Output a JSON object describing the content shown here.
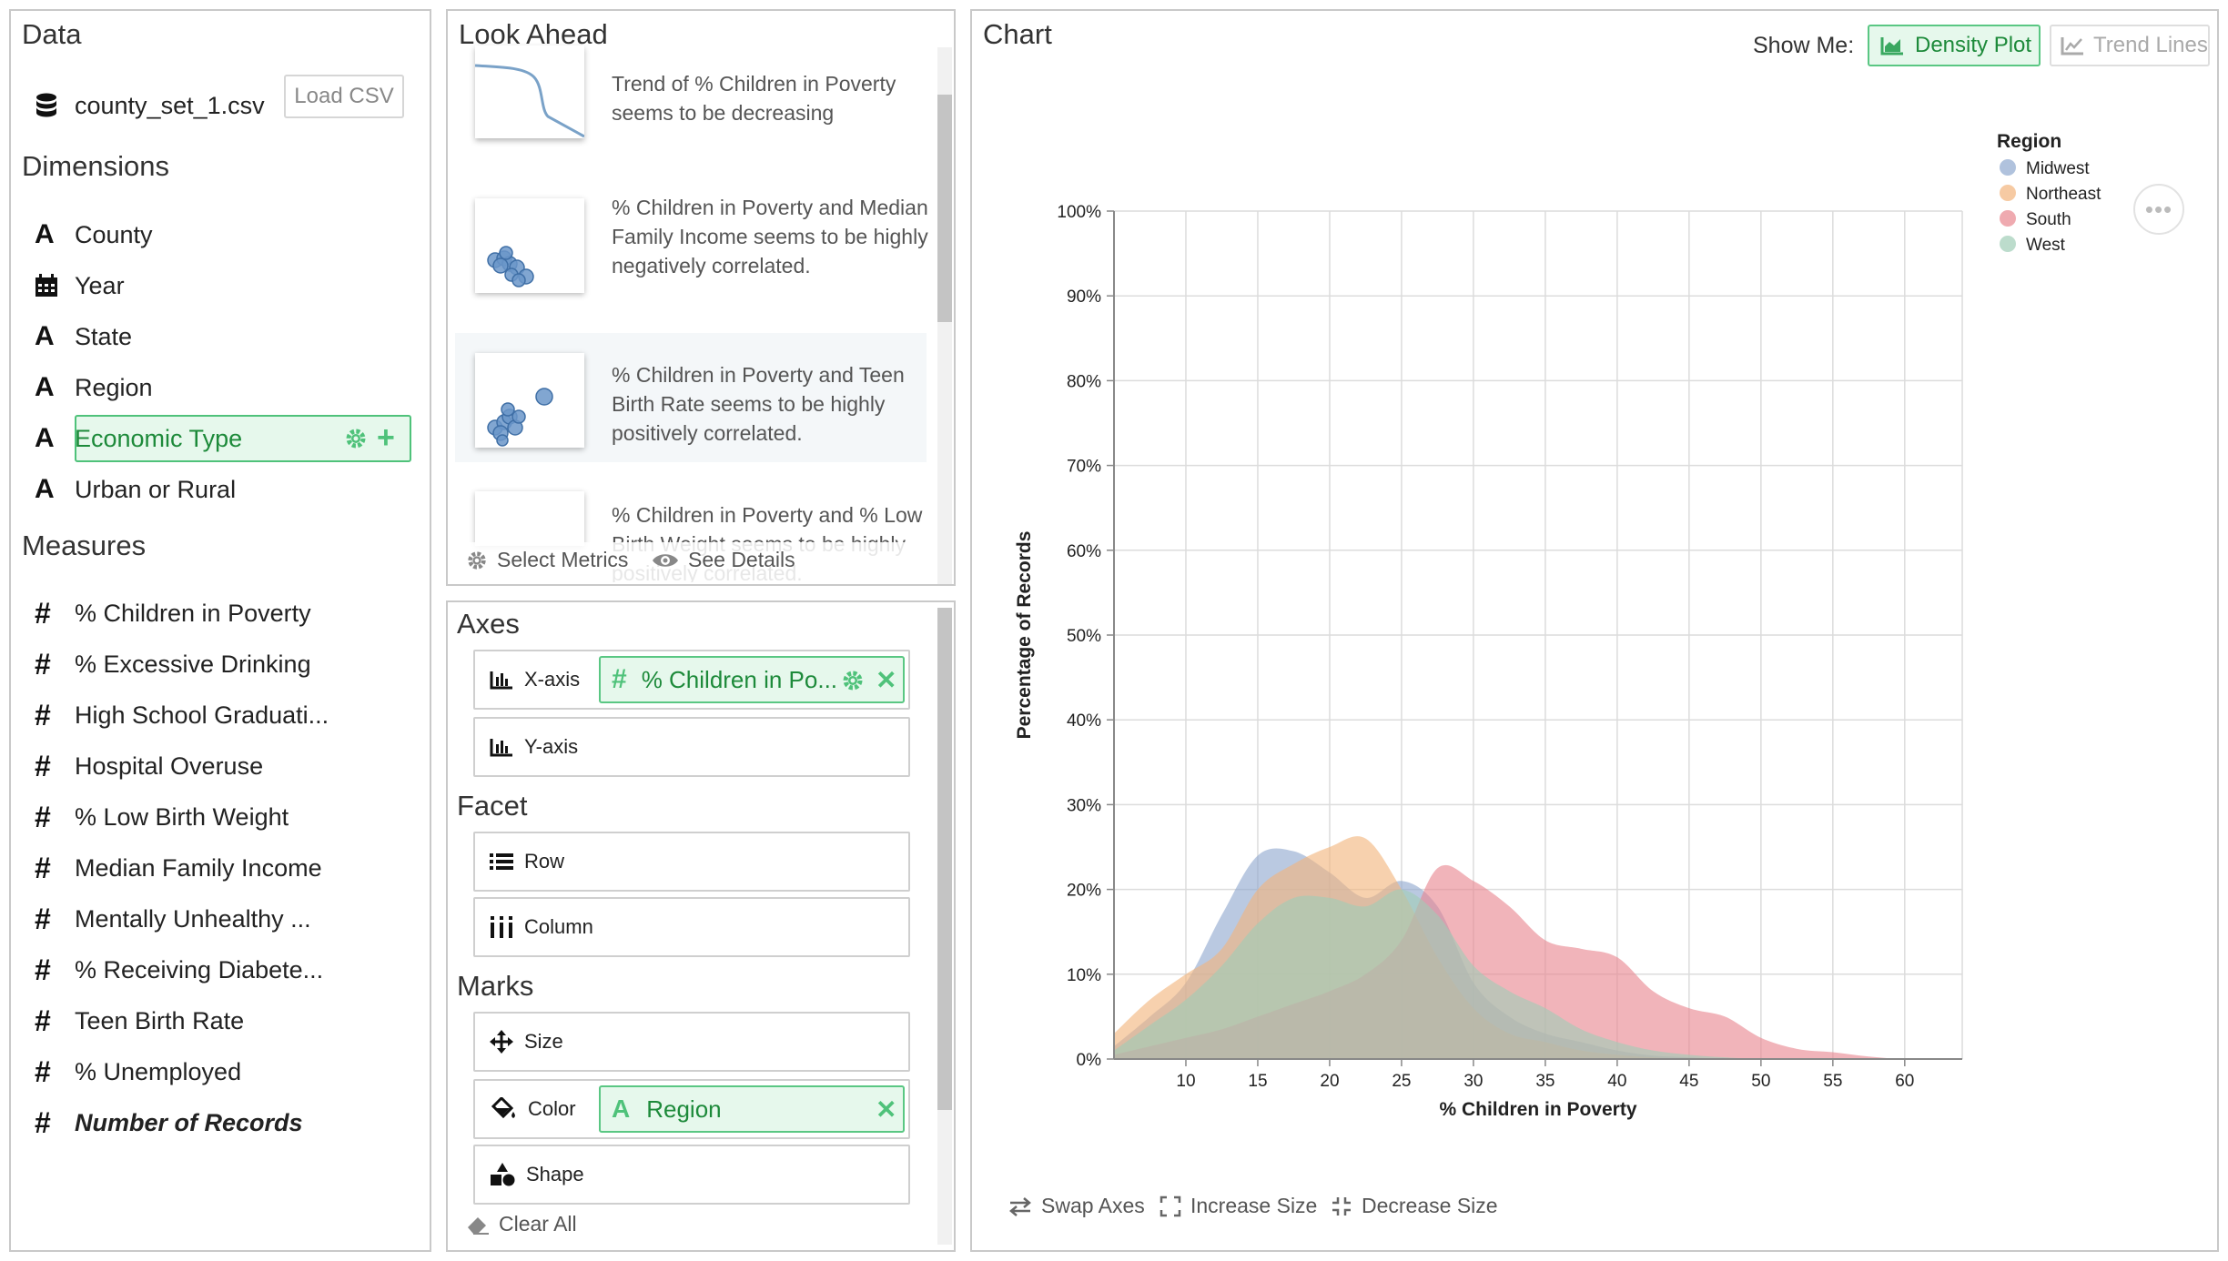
{
  "data_panel": {
    "title": "Data",
    "file_name": "county_set_1.csv",
    "load_button": "Load CSV",
    "dimensions_title": "Dimensions",
    "dimensions": [
      "County",
      "Year",
      "State",
      "Region",
      "Economic Type",
      "Urban or Rural"
    ],
    "measures_title": "Measures",
    "measures": [
      "% Children in Poverty",
      "% Excessive Drinking",
      "High School Graduati...",
      "Hospital Overuse",
      "% Low Birth Weight",
      "Median Family Income",
      "Mentally Unhealthy ...",
      "% Receiving Diabete...",
      "Teen Birth Rate",
      "% Unemployed",
      "Number of Records"
    ]
  },
  "look_ahead": {
    "title": "Look Ahead",
    "cards": [
      "Trend of % Children in Poverty seems to be decreasing",
      "% Children in Poverty and Median Family Income seems to be highly negatively correlated.",
      "% Children in Poverty and Teen Birth Rate seems to be highly positively correlated.",
      "% Children in Poverty and % Low Birth Weight seems to be highly positively correlated."
    ],
    "select_metrics": "Select Metrics",
    "see_details": "See Details"
  },
  "encodings": {
    "axes_title": "Axes",
    "x_axis": "X-axis",
    "x_axis_pill": "% Children in Po...",
    "y_axis": "Y-axis",
    "facet_title": "Facet",
    "row": "Row",
    "column": "Column",
    "marks_title": "Marks",
    "size": "Size",
    "color": "Color",
    "color_pill": "Region",
    "shape": "Shape",
    "clear_all": "Clear All"
  },
  "chart_panel": {
    "title": "Chart",
    "show_me": "Show Me:",
    "density_plot": "Density Plot",
    "trend_lines": "Trend Lines",
    "swap_axes": "Swap Axes",
    "increase_size": "Increase Size",
    "decrease_size": "Decrease Size",
    "more_icon": "ellipsis-icon"
  },
  "chart_data": {
    "type": "area",
    "subtype": "density",
    "xlabel": "% Children in Poverty",
    "ylabel": "Percentage of Records",
    "xlim": [
      5,
      64
    ],
    "ylim": [
      0,
      100
    ],
    "x_ticks": [
      10,
      15,
      20,
      25,
      30,
      35,
      40,
      45,
      50,
      55,
      60
    ],
    "y_ticks": [
      "0%",
      "10%",
      "20%",
      "30%",
      "40%",
      "50%",
      "60%",
      "70%",
      "80%",
      "90%",
      "100%"
    ],
    "legend_title": "Region",
    "legend_position": "top-right",
    "grid": true,
    "x": [
      5,
      7.5,
      10,
      12.5,
      15,
      17.5,
      20,
      22.5,
      25,
      27.5,
      30,
      32.5,
      35,
      37.5,
      40,
      42.5,
      45,
      47.5,
      50,
      52.5,
      55,
      57.5,
      60,
      62.5
    ],
    "series": [
      {
        "name": "Midwest",
        "color": "#8fa8cf",
        "values": [
          1.5,
          5,
          9,
          17,
          24,
          24.5,
          22,
          19,
          21,
          18,
          9,
          5,
          3,
          2,
          1,
          0.4,
          0.2,
          0,
          0,
          0,
          0,
          0,
          0,
          0
        ]
      },
      {
        "name": "Northeast",
        "color": "#f2b47c",
        "values": [
          3,
          7,
          10,
          13,
          20,
          23,
          25,
          26,
          20,
          12,
          6,
          3,
          2,
          1,
          0.5,
          0.2,
          0,
          0,
          0,
          0,
          0,
          0,
          0,
          0
        ]
      },
      {
        "name": "South",
        "color": "#e8868f",
        "values": [
          0.5,
          1.5,
          2.5,
          3.5,
          5,
          6.5,
          8,
          10,
          14,
          22.5,
          21,
          18,
          14,
          13,
          12,
          8,
          6,
          5,
          2.5,
          1.2,
          0.8,
          0.3,
          0,
          0
        ]
      },
      {
        "name": "West",
        "color": "#9fcdb7",
        "values": [
          1,
          4,
          7,
          11,
          16,
          19,
          19,
          18,
          20,
          17,
          11,
          8,
          6,
          3.5,
          2,
          1,
          0.5,
          0.2,
          0,
          0,
          0,
          0,
          0,
          0
        ]
      }
    ]
  }
}
